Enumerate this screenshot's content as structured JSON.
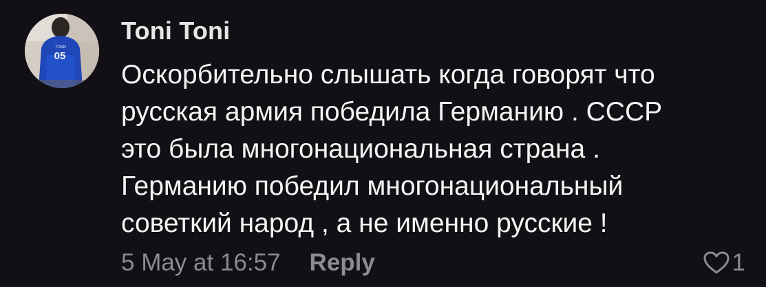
{
  "comment": {
    "author": "Toni Toni",
    "avatar": {
      "icon": "user-avatar-photo",
      "jersey_number": "05"
    },
    "text_lines": [
      "Оскорбительно слышать когда говорят что",
      "русская армия победила Германию . СССР",
      "это была многонациональная страна .",
      "Германию победил многонациональный",
      "советкий народ , а не именно русские !"
    ],
    "timestamp": "5 May at 16:57",
    "reply_label": "Reply",
    "like_icon": "heart-outline-icon",
    "like_count": "1"
  },
  "colors": {
    "background": "#121014",
    "text": "#f4f4f4",
    "muted": "#8c8b90"
  }
}
